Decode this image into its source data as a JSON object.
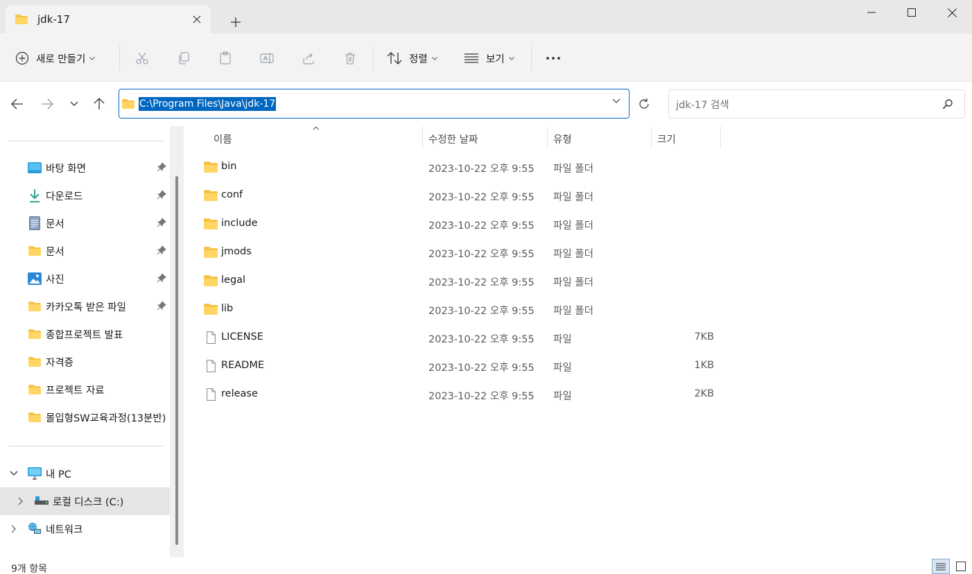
{
  "window": {
    "tab_title": "jdk-17",
    "new_tab_icon": "plus-icon",
    "minimize_icon": "minimize-icon",
    "maximize_icon": "maximize-icon",
    "close_icon": "close-icon"
  },
  "toolbar": {
    "new_label": "새로 만들기",
    "sort_label": "정렬",
    "view_label": "보기",
    "icons": [
      "cut-icon",
      "copy-icon",
      "paste-icon",
      "rename-icon",
      "share-icon",
      "delete-icon"
    ]
  },
  "address": {
    "path": "C:\\Program Files\\Java\\jdk-17"
  },
  "search": {
    "placeholder": "jdk-17 검색"
  },
  "sidebar": {
    "quick_access": [
      {
        "label": "바탕 화면",
        "icon": "desktop-icon",
        "pinned": true
      },
      {
        "label": "다운로드",
        "icon": "download-icon",
        "pinned": true
      },
      {
        "label": "문서",
        "icon": "document-icon",
        "pinned": true
      },
      {
        "label": "문서",
        "icon": "folder-icon",
        "pinned": true
      },
      {
        "label": "사진",
        "icon": "pictures-icon",
        "pinned": true
      },
      {
        "label": "카카오톡 받은 파일",
        "icon": "folder-icon",
        "pinned": true
      },
      {
        "label": "종합프로젝트 발표",
        "icon": "folder-icon",
        "pinned": false
      },
      {
        "label": "자격증",
        "icon": "folder-icon",
        "pinned": false
      },
      {
        "label": "프로젝트 자료",
        "icon": "folder-icon",
        "pinned": false
      },
      {
        "label": "몰입형SW교육과정(13분반)",
        "icon": "folder-icon",
        "pinned": false
      }
    ],
    "this_pc": "내 PC",
    "local_disk": "로컬 디스크 (C:)",
    "network": "네트워크"
  },
  "columns": {
    "name": "이름",
    "modified": "수정한 날짜",
    "type": "유형",
    "size": "크기"
  },
  "files": [
    {
      "name": "bin",
      "modified": "2023-10-22 오후 9:55",
      "type": "파일 폴더",
      "size": "",
      "kind": "folder"
    },
    {
      "name": "conf",
      "modified": "2023-10-22 오후 9:55",
      "type": "파일 폴더",
      "size": "",
      "kind": "folder"
    },
    {
      "name": "include",
      "modified": "2023-10-22 오후 9:55",
      "type": "파일 폴더",
      "size": "",
      "kind": "folder"
    },
    {
      "name": "jmods",
      "modified": "2023-10-22 오후 9:55",
      "type": "파일 폴더",
      "size": "",
      "kind": "folder"
    },
    {
      "name": "legal",
      "modified": "2023-10-22 오후 9:55",
      "type": "파일 폴더",
      "size": "",
      "kind": "folder"
    },
    {
      "name": "lib",
      "modified": "2023-10-22 오후 9:55",
      "type": "파일 폴더",
      "size": "",
      "kind": "folder"
    },
    {
      "name": "LICENSE",
      "modified": "2023-10-22 오후 9:55",
      "type": "파일",
      "size": "7KB",
      "kind": "file"
    },
    {
      "name": "README",
      "modified": "2023-10-22 오후 9:55",
      "type": "파일",
      "size": "1KB",
      "kind": "file"
    },
    {
      "name": "release",
      "modified": "2023-10-22 오후 9:55",
      "type": "파일",
      "size": "2KB",
      "kind": "file"
    }
  ],
  "status": {
    "item_count": "9개 항목"
  },
  "colors": {
    "accent": "#0067c0",
    "folder": "#f6c244",
    "toolbar_bg": "#f3f3f3",
    "titlebar_bg": "#e8e8e8"
  }
}
